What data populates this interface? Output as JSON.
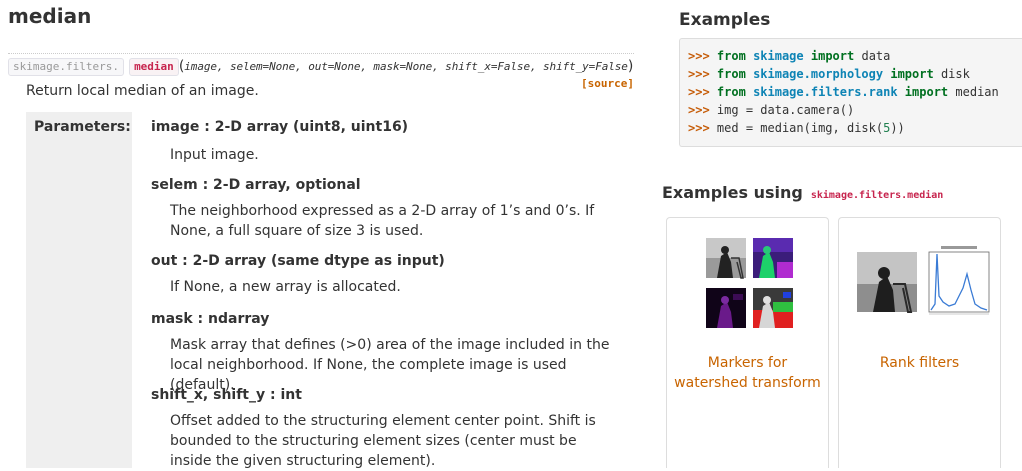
{
  "title": "median",
  "signature": {
    "module_path": "skimage.filters.",
    "func_name": "median",
    "open_paren": "(",
    "args": "image, selem=None, out=None, mask=None, shift_x=False, shift_y=False",
    "close_paren": ")"
  },
  "source_link": "[source]",
  "summary": "Return local median of an image.",
  "params_label": "Parameters:",
  "params": [
    {
      "name": "image : 2-D array (uint8, uint16)",
      "desc": "Input image."
    },
    {
      "name": "selem : 2-D array, optional",
      "desc": "The neighborhood expressed as a 2-D array of 1’s and 0’s. If None, a full square of size 3 is used."
    },
    {
      "name": "out : 2-D array (same dtype as input)",
      "desc": "If None, a new array is allocated."
    },
    {
      "name": "mask : ndarray",
      "desc": "Mask array that defines (>0) area of the image included in the local neighborhood. If None, the complete image is used (default)."
    },
    {
      "name": "shift_x, shift_y : int",
      "desc": "Offset added to the structuring element center point. Shift is bounded to the structuring element sizes (center must be inside the given structuring element)."
    }
  ],
  "examples": {
    "heading": "Examples",
    "prompt": ">>>",
    "lines": [
      {
        "k1": "from",
        "mod": "skimage",
        "k2": "import",
        "rest": "data"
      },
      {
        "k1": "from",
        "mod": "skimage.morphology",
        "k2": "import",
        "rest": "disk"
      },
      {
        "k1": "from",
        "mod": "skimage.filters.rank",
        "k2": "import",
        "rest": "median"
      }
    ],
    "line4": "img = data.camera()",
    "line5_pre": "med = median(img, disk(",
    "line5_num": "5",
    "line5_post": "))"
  },
  "examples_using": {
    "heading": "Examples using",
    "code": "skimage.filters.median",
    "cards": [
      {
        "caption_line1": "Markers for",
        "caption_line2": "watershed transform"
      },
      {
        "caption_line1": "Rank filters",
        "caption_line2": ""
      }
    ]
  },
  "colors": {
    "accent_link": "#c86400",
    "code_red": "#c7254e",
    "keyword_green": "#007020",
    "module_blue": "#0e84b5"
  }
}
